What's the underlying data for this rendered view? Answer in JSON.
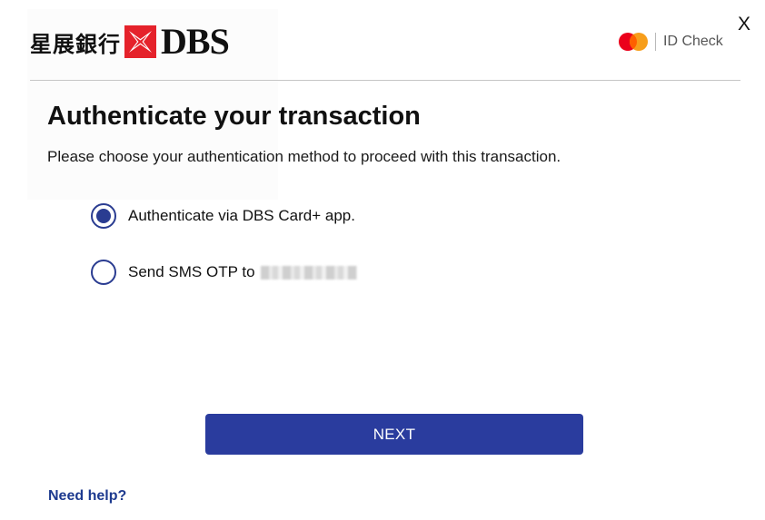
{
  "header": {
    "logo_chinese": "星展銀行",
    "logo_brand": "DBS",
    "id_check_label": "ID Check",
    "close_label": "X"
  },
  "main": {
    "title": "Authenticate your transaction",
    "subtitle": "Please choose your authentication method to proceed with this transaction.",
    "options": [
      {
        "label": "Authenticate via DBS Card+ app.",
        "selected": true
      },
      {
        "label": "Send SMS OTP to",
        "selected": false
      }
    ],
    "next_label": "NEXT",
    "help_label": "Need help?"
  },
  "colors": {
    "primary": "#2a3c9e",
    "logo_red": "#e5222b",
    "mastercard_red": "#eb001b",
    "mastercard_orange": "#f79e1b",
    "link": "#1d3a8f"
  },
  "icons": {
    "logo_mark": "dbs-star-mark-icon",
    "brand": "mastercard-icon",
    "close": "close-icon"
  }
}
